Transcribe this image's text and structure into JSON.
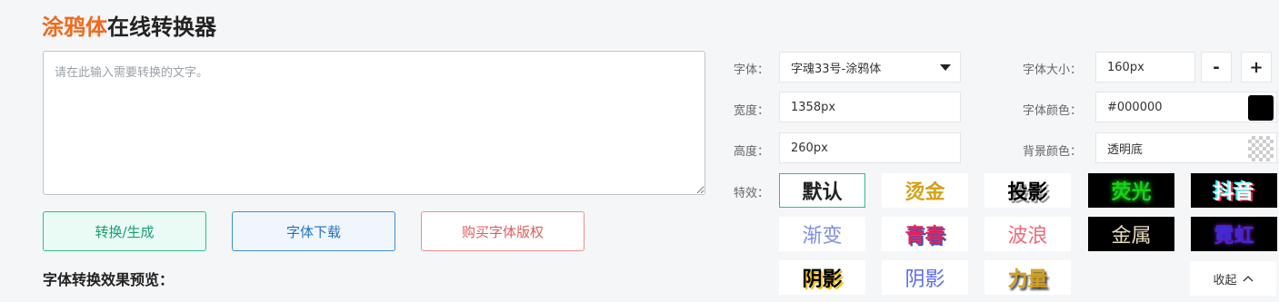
{
  "header": {
    "title_highlight": "涂鸦体",
    "title_rest": "在线转换器"
  },
  "input": {
    "placeholder": "请在此输入需要转换的文字。",
    "value": ""
  },
  "buttons": {
    "convert": "转换/生成",
    "download": "字体下载",
    "buy": "购买字体版权"
  },
  "preview": {
    "label": "字体转换效果预览："
  },
  "settings": {
    "font_label": "字体：",
    "font_value": "字魂33号-涂鸦体",
    "width_label": "宽度：",
    "width_value": "1358px",
    "height_label": "高度：",
    "height_value": "260px",
    "size_label": "字体大小：",
    "size_value": "160px",
    "minus": "-",
    "plus": "+",
    "color_label": "字体颜色：",
    "color_value": "#000000",
    "bg_label": "背景颜色：",
    "bg_value": "透明底",
    "effect_label": "特效："
  },
  "effects": [
    {
      "label": "默认"
    },
    {
      "label": "烫金"
    },
    {
      "label": "投影"
    },
    {
      "label": "荧光"
    },
    {
      "label": "抖音"
    },
    {
      "label": "渐变"
    },
    {
      "label": "青春"
    },
    {
      "label": "波浪"
    },
    {
      "label": "金属"
    },
    {
      "label": "霓虹"
    },
    {
      "label": "阴影"
    },
    {
      "label": "阴影"
    },
    {
      "label": "力量"
    }
  ],
  "collapse": {
    "label": "收起"
  },
  "colors": {
    "accent": "#f06a1d",
    "green": "#2bbf8a",
    "blue": "#3b8fd6",
    "red": "#ee8c8c",
    "font_color": "#000000"
  }
}
